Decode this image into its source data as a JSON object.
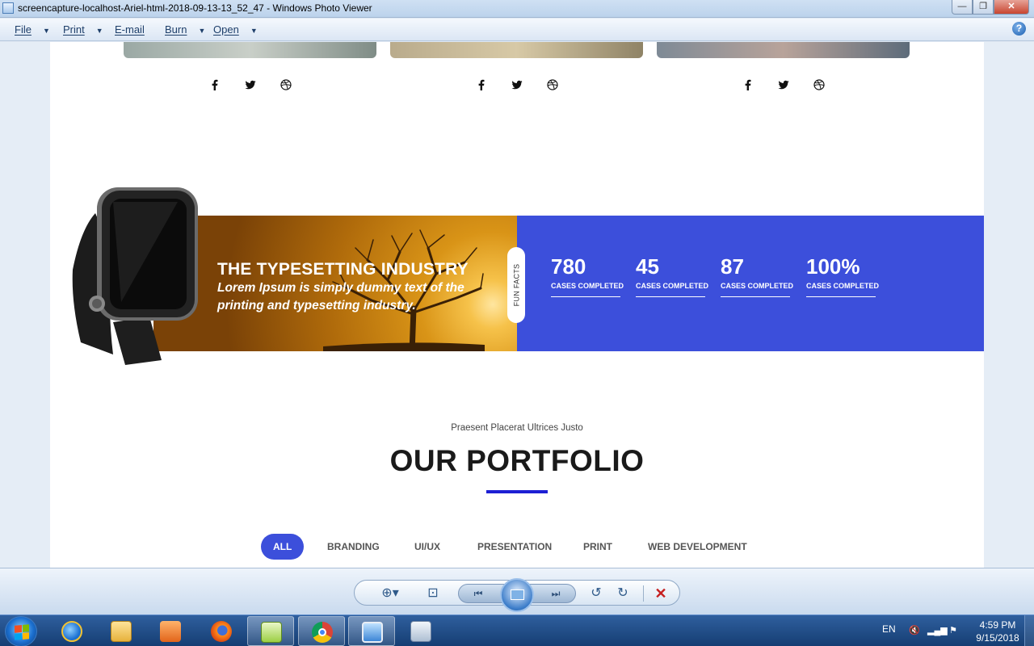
{
  "window": {
    "title": "screencapture-localhost-Ariel-html-2018-09-13-13_52_47 - Windows Photo Viewer",
    "minimize_glyph": "—",
    "maximize_glyph": "❐",
    "close_glyph": "✕"
  },
  "menu": {
    "file": "File",
    "print": "Print",
    "email": "E-mail",
    "burn": "Burn",
    "open": "Open",
    "help_glyph": "?"
  },
  "site": {
    "fun_facts": {
      "tab_label": "FUN FACTS",
      "title": "THE TYPESETTING INDUSTRY",
      "subtitle": "Lorem Ipsum is simply dummy text of the printing and typesetting industry.",
      "stats": [
        {
          "number": "780",
          "label": "CASES COMPLETED"
        },
        {
          "number": "45",
          "label": "CASES COMPLETED"
        },
        {
          "number": "87",
          "label": "CASES COMPLETED"
        },
        {
          "number": "100%",
          "label": "CASES COMPLETED"
        }
      ]
    },
    "portfolio": {
      "kicker": "Praesent Placerat Ultrices Justo",
      "title": "OUR PORTFOLIO",
      "filters": [
        "ALL",
        "BRANDING",
        "UI/UX",
        "PRESENTATION",
        "PRINT",
        "WEB DEVELOPMENT"
      ],
      "active_filter": "ALL"
    },
    "social_icons": [
      "facebook-icon",
      "twitter-icon",
      "dribbble-icon"
    ],
    "colors": {
      "accent": "#3c4fdb",
      "accent_bar": "#1d1fd4"
    }
  },
  "viewer_controls": {
    "zoom_glyph": "⊕▾",
    "fit_glyph": "⊡",
    "prev_glyph": "⏮",
    "next_glyph": "⏭",
    "rotate_left_glyph": "↺",
    "rotate_right_glyph": "↻",
    "delete_glyph": "✕"
  },
  "taskbar": {
    "language": "EN",
    "time": "4:59 PM",
    "date": "9/15/2018"
  }
}
